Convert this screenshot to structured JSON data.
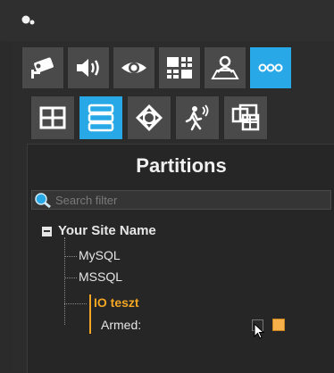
{
  "toolbar_row1": [
    {
      "icon": "camera-icon"
    },
    {
      "icon": "speaker-icon"
    },
    {
      "icon": "eye-icon"
    },
    {
      "icon": "layout-grid-icon"
    },
    {
      "icon": "map-user-icon"
    },
    {
      "icon": "more-icon",
      "active": true
    }
  ],
  "toolbar_row2": [
    {
      "icon": "window-grid-icon"
    },
    {
      "icon": "partitions-list-icon",
      "active": true
    },
    {
      "icon": "ptz-icon"
    },
    {
      "icon": "motion-runner-icon"
    },
    {
      "icon": "multi-window-icon"
    }
  ],
  "panel": {
    "title": "Partitions",
    "search_placeholder": "Search filter"
  },
  "tree": {
    "site_name": "Your Site Name",
    "children": [
      "MySQL",
      "MSSQL"
    ],
    "selected_partition": "IO teszt",
    "armed_label": "Armed:"
  },
  "colors": {
    "accent": "#29a8e8",
    "selected_text": "#f5a623",
    "armed_indicator": "#f5b04a"
  }
}
